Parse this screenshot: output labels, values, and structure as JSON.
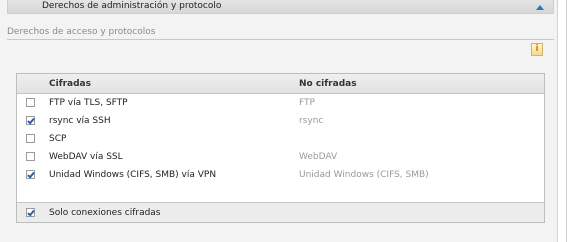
{
  "section": {
    "title": "Derechos de administración y protocolo"
  },
  "subsection": {
    "title": "Derechos de acceso y protocolos"
  },
  "table": {
    "columns": [
      "Cifradas",
      "No cifradas"
    ],
    "rows": [
      {
        "checked": false,
        "encrypted": "FTP vía TLS, SFTP",
        "unencrypted": "FTP"
      },
      {
        "checked": true,
        "encrypted": "rsync vía SSH",
        "unencrypted": "rsync"
      },
      {
        "checked": false,
        "encrypted": "SCP",
        "unencrypted": ""
      },
      {
        "checked": false,
        "encrypted": "WebDAV vía SSL",
        "unencrypted": "WebDAV"
      },
      {
        "checked": true,
        "encrypted": "Unidad Windows (CIFS, SMB) vía VPN",
        "unencrypted": "Unidad Windows (CIFS, SMB)"
      }
    ],
    "footer": {
      "checked": true,
      "label": "Solo conexiones cifradas"
    }
  },
  "icons": {
    "collapse": "chevron-up-icon",
    "info": "info-icon"
  },
  "colors": {
    "accent": "#2f6fd0",
    "info": "#e07a00"
  }
}
